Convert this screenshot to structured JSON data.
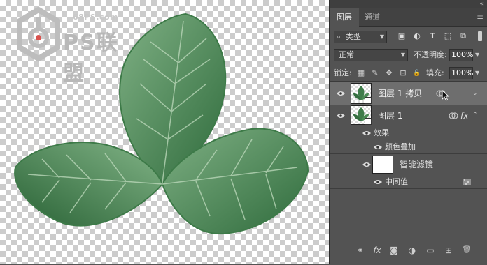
{
  "watermark": {
    "site": "68PS.com",
    "logo_text": "PS联盟"
  },
  "panel": {
    "collapse_glyph": "«",
    "tabs": [
      {
        "label": "图层",
        "active": true
      },
      {
        "label": "通道",
        "active": false
      }
    ],
    "menu_glyph": "≡",
    "filter": {
      "kind_label": "类型",
      "search_glyph": "⌕",
      "buttons": [
        {
          "name": "pixel-filter-icon",
          "glyph": "▣"
        },
        {
          "name": "adjustment-filter-icon",
          "glyph": "◐"
        },
        {
          "name": "type-filter-icon",
          "glyph": "T"
        },
        {
          "name": "shape-filter-icon",
          "glyph": "⬚"
        },
        {
          "name": "smart-object-filter-icon",
          "glyph": "⧉"
        }
      ]
    },
    "blend_mode": "正常",
    "opacity_label": "不透明度:",
    "opacity_value": "100%",
    "lock_label": "锁定:",
    "lock_icons": [
      {
        "name": "lock-transparent-pixels-icon",
        "glyph": "▦"
      },
      {
        "name": "lock-image-pixels-icon",
        "glyph": "✎"
      },
      {
        "name": "lock-position-icon",
        "glyph": "✥"
      },
      {
        "name": "lock-artboard-icon",
        "glyph": "⊡"
      },
      {
        "name": "lock-all-icon",
        "glyph": "🔒"
      }
    ],
    "fill_label": "填充:",
    "fill_value": "100%",
    "layers": [
      {
        "name": "图层 1 拷贝",
        "selected": true
      },
      {
        "name": "图层 1",
        "selected": false,
        "fx": "fx"
      }
    ],
    "effects_label": "效果",
    "effect_item": "颜色叠加",
    "smart_filters_label": "智能滤镜",
    "filter_item": "中间值",
    "footer_glyphs": [
      "⚭",
      "fx",
      "◙",
      "◑",
      "▭",
      "⊞",
      "🗑"
    ]
  },
  "colors": {
    "panel_bg": "#535353",
    "selected_row": "#6e6e6e",
    "leaf_dark": "#2f6b3c",
    "leaf_light": "#6fa276"
  }
}
